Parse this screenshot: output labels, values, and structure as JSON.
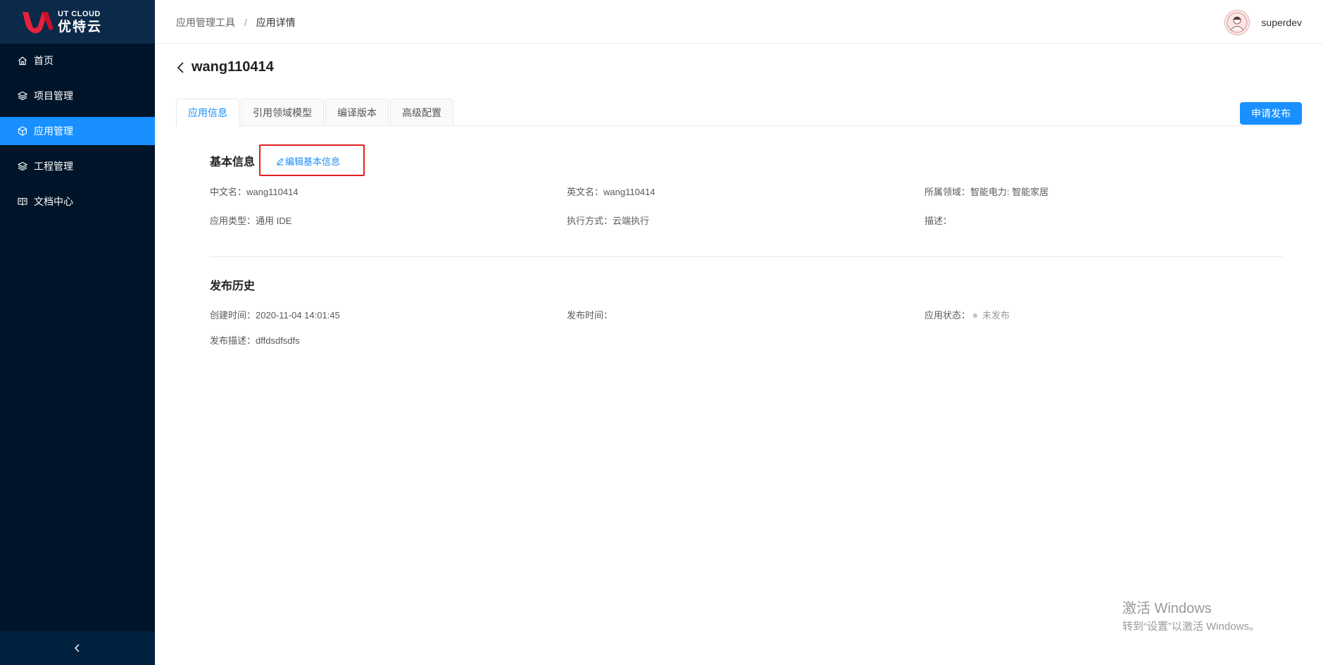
{
  "brand": {
    "name_en": "UT CLOUD",
    "name_cn": "优特云",
    "accent": "#1890ff",
    "sidebar_bg": "#001529"
  },
  "sidebar": {
    "items": [
      {
        "label": "首页",
        "icon": "home-icon",
        "active": false
      },
      {
        "label": "项目管理",
        "icon": "layers-icon",
        "active": false
      },
      {
        "label": "应用管理",
        "icon": "cube-icon",
        "active": true
      },
      {
        "label": "工程管理",
        "icon": "layers-icon",
        "active": false
      },
      {
        "label": "文档中心",
        "icon": "book-icon",
        "active": false
      }
    ],
    "collapse_icon": "chevron-left-icon"
  },
  "header": {
    "breadcrumb": [
      "应用管理工具",
      "应用详情"
    ],
    "breadcrumb_sep": "/",
    "username": "superdev"
  },
  "page": {
    "title": "wang110414",
    "publish_label": "申请发布",
    "tabs": [
      {
        "label": "应用信息",
        "active": true
      },
      {
        "label": "引用领域模型",
        "active": false
      },
      {
        "label": "编译版本",
        "active": false
      },
      {
        "label": "高级配置",
        "active": false
      }
    ]
  },
  "basic_info": {
    "title": "基本信息",
    "edit_label": "编辑基本信息",
    "cn_name_label": "中文名：",
    "cn_name": "wang110414",
    "en_name_label": "英文名：",
    "en_name": "wang110414",
    "domain_label": "所属领域：",
    "domain": "智能电力: 智能家居",
    "app_type_label": "应用类型：",
    "app_type": "通用 IDE",
    "exec_label": "执行方式：",
    "exec": "云端执行",
    "desc_label": "描述：",
    "desc": ""
  },
  "publish_history": {
    "title": "发布历史",
    "created_label": "创建时间：",
    "created": "2020-11-04 14:01:45",
    "published_label": "发布时间：",
    "published": "",
    "status_label": "应用状态：",
    "status": "未发布",
    "pub_desc_label": "发布描述：",
    "pub_desc": "dffdsdfsdfs"
  },
  "watermark": {
    "line1": "激活 Windows",
    "line2": "转到“设置”以激活 Windows。"
  }
}
